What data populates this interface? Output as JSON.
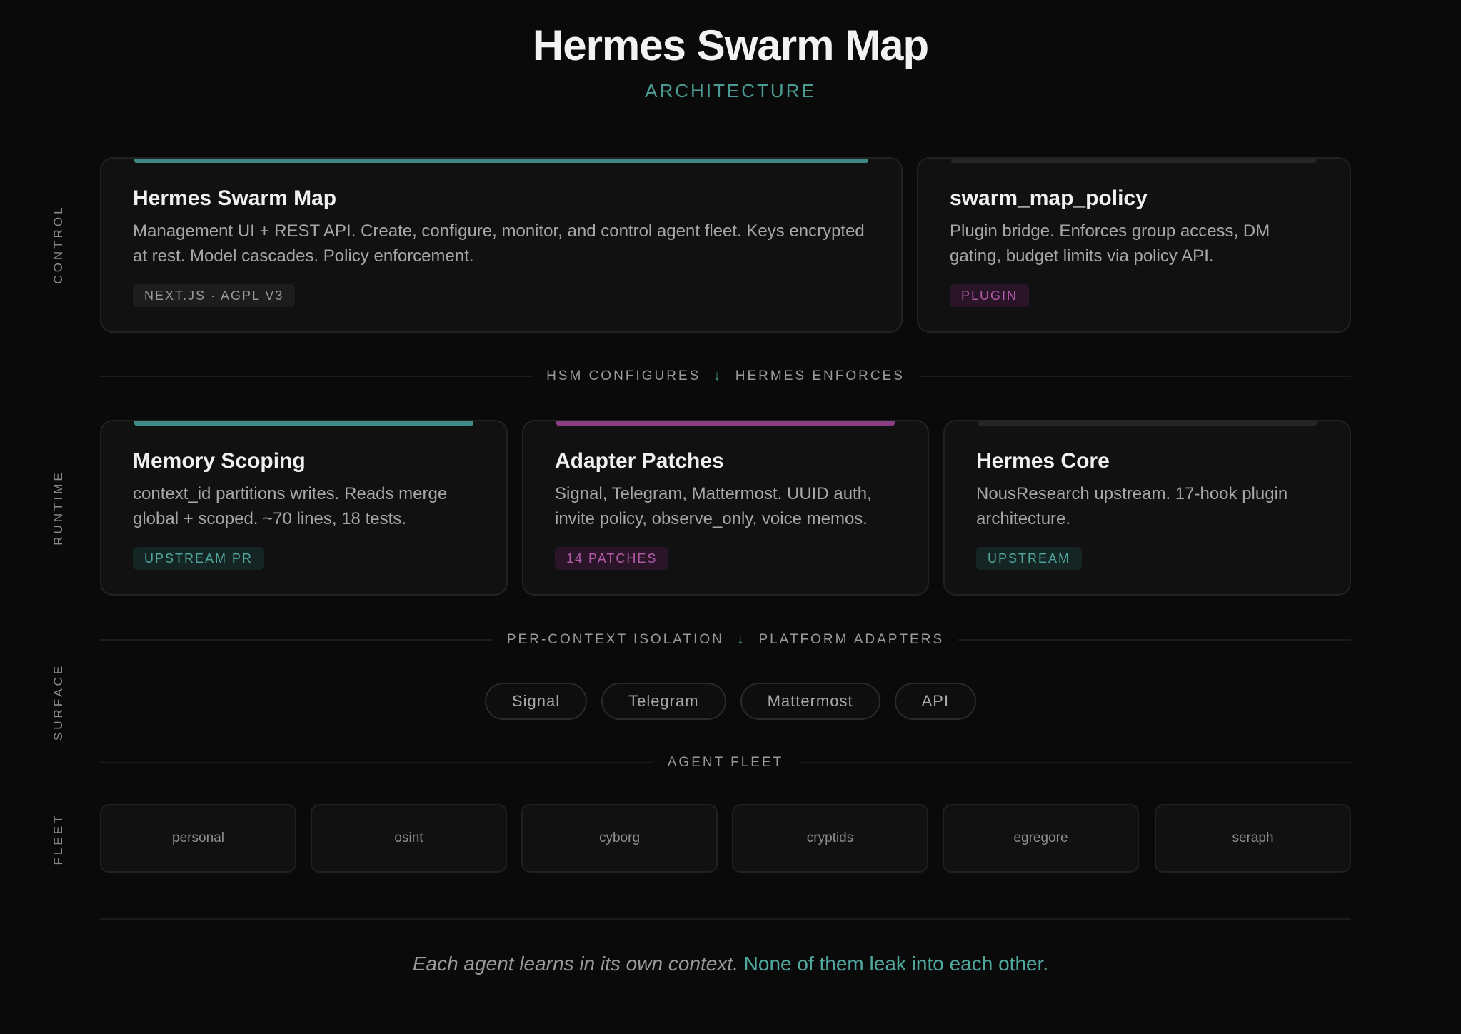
{
  "header": {
    "title": "Hermes Swarm Map",
    "subtitle": "ARCHITECTURE"
  },
  "colors": {
    "background": "#0a0a0a",
    "teal": "#4a9a93",
    "purple": "#b35aa9",
    "card": "#111111"
  },
  "side_labels": {
    "control": "CONTROL",
    "runtime": "RUNTIME",
    "surface": "SURFACE",
    "fleet": "FLEET"
  },
  "control": {
    "cards": [
      {
        "title": "Hermes Swarm Map",
        "description": "Management UI + REST API. Create, configure, monitor, and control agent fleet. Keys encrypted at rest. Model cascades. Policy enforcement.",
        "tag": "NEXT.JS · AGPL V3",
        "accent": "teal"
      },
      {
        "title": "swarm_map_policy",
        "description": "Plugin bridge. Enforces group access, DM gating, budget limits via policy API.",
        "tag": "PLUGIN",
        "accent": "dark"
      }
    ]
  },
  "flow1": {
    "left": "HSM CONFIGURES",
    "arrow": "↓",
    "right": "HERMES ENFORCES"
  },
  "runtime": {
    "cards": [
      {
        "title": "Memory Scoping",
        "description": "context_id partitions writes. Reads merge global + scoped. ~70 lines, 18 tests.",
        "tag": "UPSTREAM PR",
        "accent": "teal"
      },
      {
        "title": "Adapter Patches",
        "description": "Signal, Telegram, Mattermost. UUID auth, invite policy, observe_only, voice memos.",
        "tag": "14 PATCHES",
        "accent": "purple"
      },
      {
        "title": "Hermes Core",
        "description": "NousResearch upstream. 17-hook plugin architecture.",
        "tag": "UPSTREAM",
        "accent": "dark"
      }
    ]
  },
  "flow2": {
    "left": "PER-CONTEXT ISOLATION",
    "arrow": "↓",
    "right": "PLATFORM ADAPTERS"
  },
  "surface": {
    "platforms": [
      "Signal",
      "Telegram",
      "Mattermost",
      "API"
    ]
  },
  "fleet_divider": {
    "label": "AGENT FLEET"
  },
  "fleet": {
    "agents": [
      "personal",
      "osint",
      "cyborg",
      "cryptids",
      "egregore",
      "seraph"
    ]
  },
  "footer": {
    "italic": "Each agent learns in its own context.",
    "highlight": "None of them leak into each other."
  }
}
